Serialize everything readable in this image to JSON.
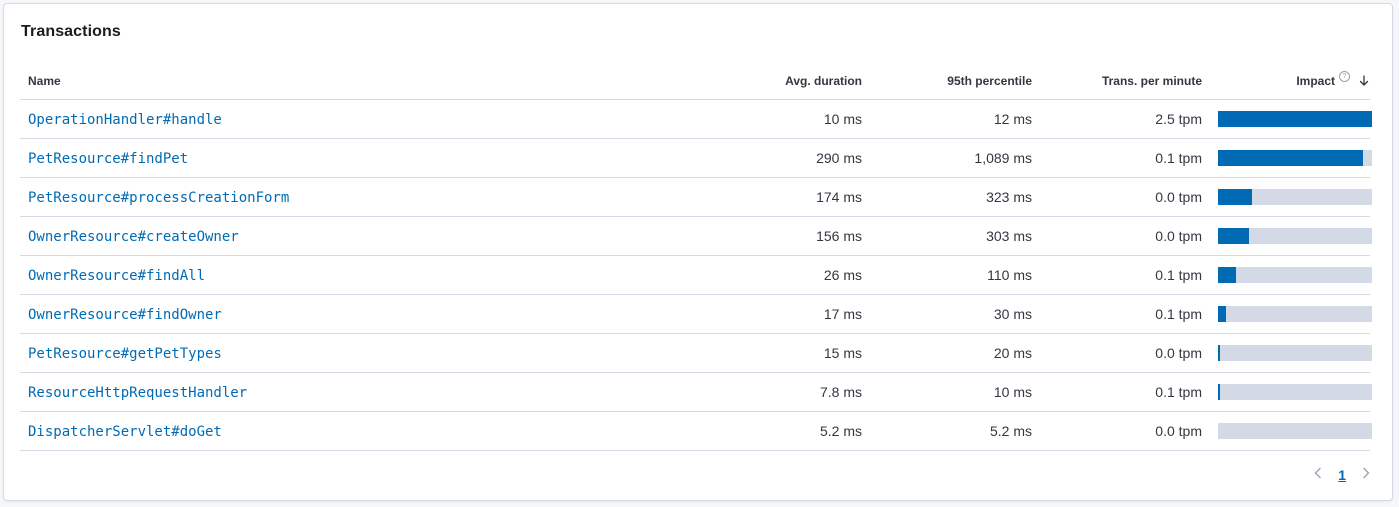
{
  "panel": {
    "title": "Transactions"
  },
  "table": {
    "columns": {
      "name": "Name",
      "avg_duration": "Avg. duration",
      "p95": "95th percentile",
      "tpm": "Trans. per minute",
      "impact": "Impact"
    },
    "rows": [
      {
        "name": "OperationHandler#handle",
        "avg": "10 ms",
        "p95": "12 ms",
        "tpm": "2.5 tpm",
        "impact": 1.0
      },
      {
        "name": "PetResource#findPet",
        "avg": "290 ms",
        "p95": "1,089 ms",
        "tpm": "0.1 tpm",
        "impact": 0.94
      },
      {
        "name": "PetResource#processCreationForm",
        "avg": "174 ms",
        "p95": "323 ms",
        "tpm": "0.0 tpm",
        "impact": 0.22
      },
      {
        "name": "OwnerResource#createOwner",
        "avg": "156 ms",
        "p95": "303 ms",
        "tpm": "0.0 tpm",
        "impact": 0.2
      },
      {
        "name": "OwnerResource#findAll",
        "avg": "26 ms",
        "p95": "110 ms",
        "tpm": "0.1 tpm",
        "impact": 0.12
      },
      {
        "name": "OwnerResource#findOwner",
        "avg": "17 ms",
        "p95": "30 ms",
        "tpm": "0.1 tpm",
        "impact": 0.05
      },
      {
        "name": "PetResource#getPetTypes",
        "avg": "15 ms",
        "p95": "20 ms",
        "tpm": "0.0 tpm",
        "impact": 0.013
      },
      {
        "name": "ResourceHttpRequestHandler",
        "avg": "7.8 ms",
        "p95": "10 ms",
        "tpm": "0.1 tpm",
        "impact": 0.013
      },
      {
        "name": "DispatcherServlet#doGet",
        "avg": "5.2 ms",
        "p95": "5.2 ms",
        "tpm": "0.0 tpm",
        "impact": 0.0
      }
    ]
  },
  "pagination": {
    "current_page": "1",
    "prev_icon": "chevron-left-icon",
    "next_icon": "chevron-right-icon"
  },
  "colors": {
    "accent": "#006bb4",
    "bar_background": "#d3dae6",
    "border": "#d3dae6"
  }
}
